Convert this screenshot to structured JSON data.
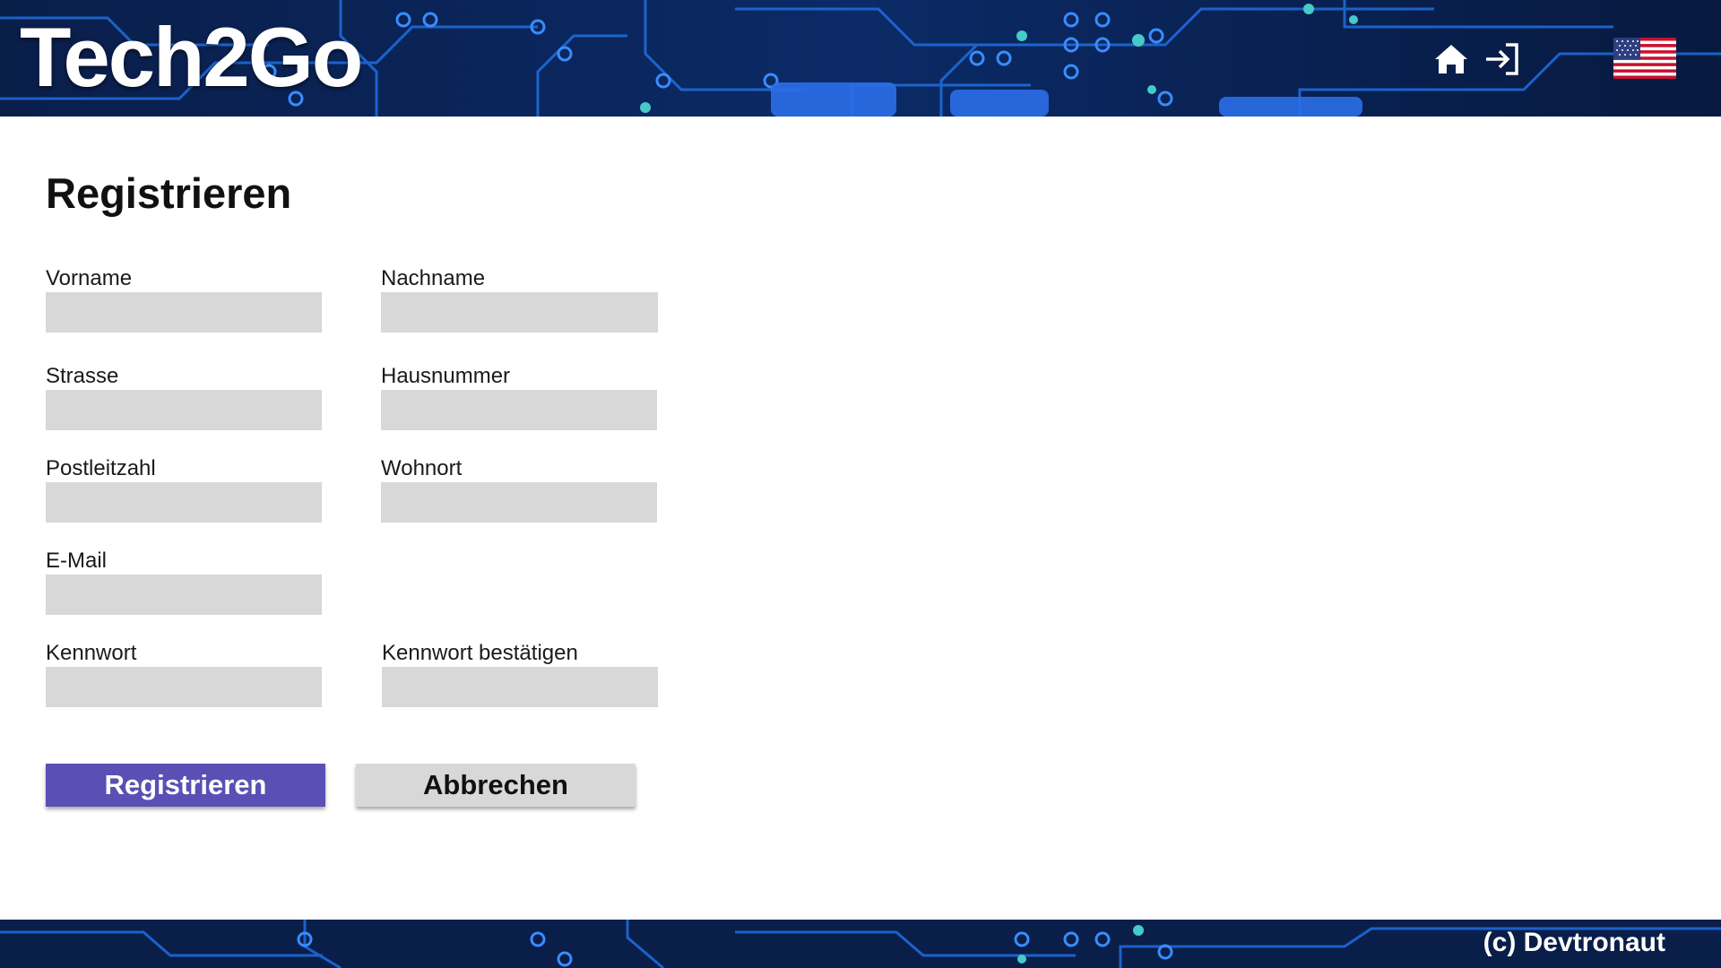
{
  "header": {
    "logo": "Tech2Go",
    "icons": [
      "home-icon",
      "login-icon",
      "us-flag-icon"
    ]
  },
  "page": {
    "title": "Registrieren"
  },
  "form": {
    "first_name": {
      "label": "Vorname",
      "value": ""
    },
    "last_name": {
      "label": "Nachname",
      "value": ""
    },
    "street": {
      "label": "Strasse",
      "value": ""
    },
    "house_number": {
      "label": "Hausnummer",
      "value": ""
    },
    "postal_code": {
      "label": "Postleitzahl",
      "value": ""
    },
    "city": {
      "label": "Wohnort",
      "value": ""
    },
    "email": {
      "label": "E-Mail",
      "value": ""
    },
    "password": {
      "label": "Kennwort",
      "value": ""
    },
    "password_confirm": {
      "label": "Kennwort bestätigen",
      "value": ""
    }
  },
  "actions": {
    "register_label": "Registrieren",
    "cancel_label": "Abbrechen"
  },
  "footer": {
    "copyright": "(c) Devtronaut"
  },
  "colors": {
    "primary": "#5a4fb5",
    "input_bg": "#d8d8d8",
    "circuit_bg": "#061634",
    "circuit_trace": "#1e6fe0"
  }
}
